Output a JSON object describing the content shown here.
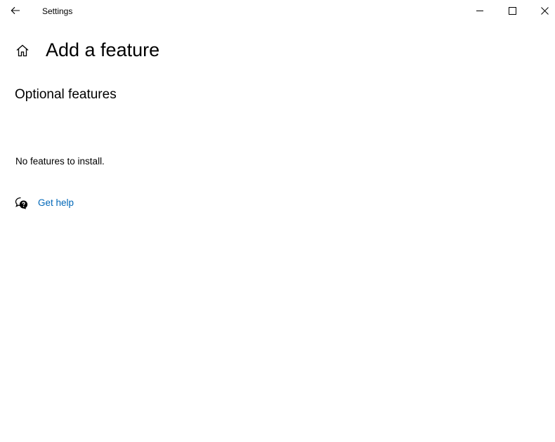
{
  "window": {
    "title": "Settings",
    "back_icon": "arrow-left-icon",
    "minimize_icon": "minimize-icon",
    "maximize_icon": "maximize-icon",
    "close_icon": "close-icon"
  },
  "header": {
    "home_icon": "home-icon",
    "title": "Add a feature"
  },
  "main": {
    "section_title": "Optional features",
    "status": "No features to install."
  },
  "help": {
    "icon": "chat-question-icon",
    "link_label": "Get help",
    "link_color": "#0067b8"
  }
}
